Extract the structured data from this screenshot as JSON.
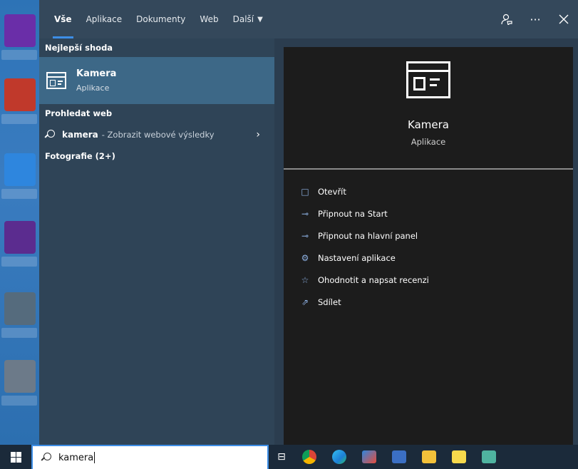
{
  "tabs": [
    {
      "label": "Vše"
    },
    {
      "label": "Aplikace"
    },
    {
      "label": "Dokumenty"
    },
    {
      "label": "Web"
    },
    {
      "label": "Další"
    }
  ],
  "topbar_icons": {
    "feedback": "feedback-icon",
    "more": "more-icon",
    "close": "close-icon"
  },
  "results": {
    "best_match_label": "Nejlepší shoda",
    "best_match": {
      "name": "Kamera",
      "type": "Aplikace",
      "icon": "camera-app-icon"
    },
    "search_web_label": "Prohledat web",
    "web_query": "kamera",
    "web_suffix": "- Zobrazit webové výsledky",
    "photos_label": "Fotografie (2+)"
  },
  "detail": {
    "title": "Kamera",
    "subtitle": "Aplikace",
    "actions": [
      {
        "label": "Otevřít",
        "icon": "open-icon"
      },
      {
        "label": "Připnout na Start",
        "icon": "pin-icon"
      },
      {
        "label": "Připnout na hlavní panel",
        "icon": "pin-icon"
      },
      {
        "label": "Nastavení aplikace",
        "icon": "gear-icon"
      },
      {
        "label": "Ohodnotit a napsat recenzi",
        "icon": "star-list-icon"
      },
      {
        "label": "Sdílet",
        "icon": "share-icon"
      }
    ]
  },
  "taskbar": {
    "search_value": "kamera",
    "apps": [
      "chrome-icon",
      "edge-icon",
      "app-icon",
      "app-icon",
      "folder-icon",
      "sticky-notes-icon",
      "app-icon"
    ]
  },
  "colors": {
    "accent": "#3d8ee6",
    "best_match_bg": "#3d6887",
    "panel_bg": "#2f4457",
    "detail_bg": "#1c1c1c"
  }
}
